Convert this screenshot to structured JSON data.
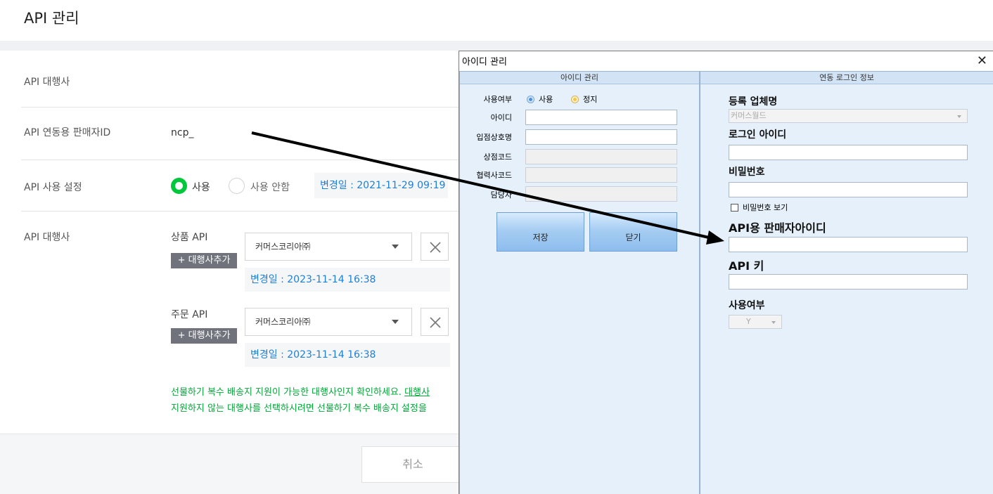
{
  "page": {
    "title": "API 관리",
    "rows": {
      "agency_label": "API 대행사",
      "seller_id_label": "API 연동용 판매자ID",
      "seller_id_value": "ncp_",
      "usage_label": "API 사용 설정",
      "usage_on": "사용",
      "usage_off": "사용 안함",
      "usage_changed": "변경일 : 2021-11-29 09:19",
      "agency2_label": "API 대행사"
    },
    "product_api": {
      "label": "상품 API",
      "add_button": "+ 대행사추가",
      "selected": "커머스코리아㈜",
      "changed": "변경일 : 2023-11-14 16:38"
    },
    "order_api": {
      "label": "주문 API",
      "add_button": "+ 대행사추가",
      "selected": "커머스코리아㈜",
      "changed": "변경일 : 2023-11-14 16:38"
    },
    "note_line1": "선물하기 복수 배송지 지원이 가능한 대행사인지 확인하세요.",
    "note_link": "대행사",
    "note_line2": "지원하지 않는 대행사를 선택하시려면 선물하기 복수 배송지 설정을",
    "cancel_button": "취소"
  },
  "dialog": {
    "title": "아이디 관리",
    "close_glyph": "✕",
    "left_pane": {
      "header": "아이디 관리",
      "usage_label": "사용여부",
      "usage_on": "사용",
      "usage_stop": "정지",
      "id_label": "아이디",
      "shop_name_label": "입점상호명",
      "shop_code_label": "상점코드",
      "partner_code_label": "협력사코드",
      "manager_label": "담당자",
      "save_button": "저장",
      "close_button": "닫기"
    },
    "right_pane": {
      "header": "연동 로그인 정보",
      "company_label": "등록 업체명",
      "company_value": "커머스월드",
      "login_id_label": "로그인 아이디",
      "password_label": "비밀번호",
      "show_password": "비밀번호 보기",
      "api_seller_id_label": "API용 판매자아이디",
      "api_key_label": "API 키",
      "usage_label": "사용여부",
      "usage_value": "Y"
    }
  },
  "colors": {
    "accent_green": "#00c73c",
    "link_blue": "#1e7fd6",
    "pane_blue": "#e6f0fa"
  }
}
